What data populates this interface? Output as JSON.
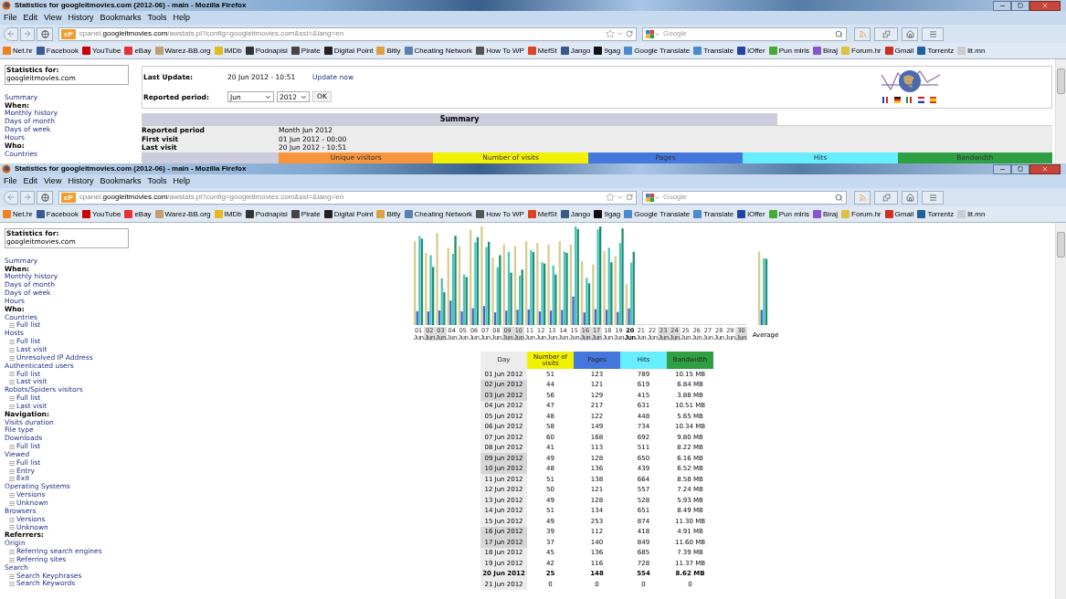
{
  "windows": [
    {
      "title": "Statistics for googleitmovies.com (2012-06) - main - Mozilla Firefox",
      "menu": [
        "File",
        "Edit",
        "View",
        "History",
        "Bookmarks",
        "Tools",
        "Help"
      ],
      "url": {
        "badge": "cP",
        "prefix": "cpanel.",
        "domain": "googleitmovies.com",
        "rest": "/awstats.pl?config=googleitmovies.com&ssl=&lang=en"
      },
      "search_placeholder": "Google",
      "bookmarks": [
        {
          "label": "Net.hr",
          "color": "#f08020"
        },
        {
          "label": "Facebook",
          "color": "#3b5998"
        },
        {
          "label": "YouTube",
          "color": "#cc0000"
        },
        {
          "label": "eBay",
          "color": "#e53238"
        },
        {
          "label": "Warez-BB.org",
          "color": "#c0a070"
        },
        {
          "label": "IMDb",
          "color": "#e6b91e"
        },
        {
          "label": "Podnapisi",
          "color": "#333333"
        },
        {
          "label": "Pirate",
          "color": "#444444"
        },
        {
          "label": "Digital Point",
          "color": "#222222"
        },
        {
          "label": "Bitly",
          "color": "#e0a040"
        },
        {
          "label": "Cheating Network",
          "color": "#5a7fb0"
        },
        {
          "label": "How To WP",
          "color": "#555555"
        },
        {
          "label": "MefSt",
          "color": "#dd4422"
        },
        {
          "label": "Jango",
          "color": "#3a5a8a"
        },
        {
          "label": "9gag",
          "color": "#111111"
        },
        {
          "label": "Google Translate",
          "color": "#4a8ad0"
        },
        {
          "label": "Translate",
          "color": "#4a8ad0"
        },
        {
          "label": "iOffer",
          "color": "#2244aa"
        },
        {
          "label": "Pun miris",
          "color": "#44aa33"
        },
        {
          "label": "Biraj",
          "color": "#8855cc"
        },
        {
          "label": "Forum.hr",
          "color": "#e0c040"
        },
        {
          "label": "Gmail",
          "color": "#d03020"
        },
        {
          "label": "Torrentz",
          "color": "#2060a0"
        },
        {
          "label": "lit.mn",
          "color": "#cccccc"
        }
      ],
      "sidebar": {
        "box_label": "Statistics for:",
        "box_value": "googleitmovies.com",
        "items": [
          {
            "kind": "link",
            "label": "Summary"
          },
          {
            "kind": "heading",
            "label": "When:"
          },
          {
            "kind": "link",
            "label": "Monthly history"
          },
          {
            "kind": "link",
            "label": "Days of month"
          },
          {
            "kind": "link",
            "label": "Days of week"
          },
          {
            "kind": "link",
            "label": "Hours"
          },
          {
            "kind": "heading",
            "label": "Who:"
          },
          {
            "kind": "link",
            "label": "Countries"
          }
        ]
      },
      "content": {
        "kind": "summary",
        "last_update_label": "Last Update:",
        "last_update": "20 Jun 2012 - 10:51",
        "update_link": "Update now",
        "period_label": "Reported period:",
        "month_select": "Jun",
        "year_select": "2012",
        "ok_button": "OK",
        "summary_title": "Summary",
        "summary_rows": [
          {
            "label": "Reported period",
            "value": "Month Jun 2012"
          },
          {
            "label": "First visit",
            "value": "01 Jun 2012 - 00:00"
          },
          {
            "label": "Last visit",
            "value": "20 Jun 2012 - 10:51"
          }
        ],
        "columns": [
          {
            "label": "Unique visitors",
            "color": "#f8953a"
          },
          {
            "label": "Number of visits",
            "color": "#f2f200"
          },
          {
            "label": "Pages",
            "color": "#4477dd"
          },
          {
            "label": "Hits",
            "color": "#66eeff"
          },
          {
            "label": "Bandwidth",
            "color": "#2ea043"
          }
        ]
      }
    },
    {
      "title": "Statistics for googleitmovies.com (2012-06) - main - Mozilla Firefox",
      "menu": [
        "File",
        "Edit",
        "View",
        "History",
        "Bookmarks",
        "Tools",
        "Help"
      ],
      "url": {
        "badge": "cP",
        "prefix": "cpanel.",
        "domain": "googleitmovies.com",
        "rest": "/awstats.pl?config=googleitmovies.com&ssl=&lang=en"
      },
      "search_placeholder": "Google",
      "bookmarks": [
        {
          "label": "Net.hr",
          "color": "#f08020"
        },
        {
          "label": "Facebook",
          "color": "#3b5998"
        },
        {
          "label": "YouTube",
          "color": "#cc0000"
        },
        {
          "label": "eBay",
          "color": "#e53238"
        },
        {
          "label": "Warez-BB.org",
          "color": "#c0a070"
        },
        {
          "label": "IMDb",
          "color": "#e6b91e"
        },
        {
          "label": "Podnapisi",
          "color": "#333333"
        },
        {
          "label": "Pirate",
          "color": "#444444"
        },
        {
          "label": "Digital Point",
          "color": "#222222"
        },
        {
          "label": "Bitly",
          "color": "#e0a040"
        },
        {
          "label": "Cheating Network",
          "color": "#5a7fb0"
        },
        {
          "label": "How To WP",
          "color": "#555555"
        },
        {
          "label": "MefSt",
          "color": "#dd4422"
        },
        {
          "label": "Jango",
          "color": "#3a5a8a"
        },
        {
          "label": "9gag",
          "color": "#111111"
        },
        {
          "label": "Google Translate",
          "color": "#4a8ad0"
        },
        {
          "label": "Translate",
          "color": "#4a8ad0"
        },
        {
          "label": "iOffer",
          "color": "#2244aa"
        },
        {
          "label": "Pun miris",
          "color": "#44aa33"
        },
        {
          "label": "Biraj",
          "color": "#8855cc"
        },
        {
          "label": "Forum.hr",
          "color": "#e0c040"
        },
        {
          "label": "Gmail",
          "color": "#d03020"
        },
        {
          "label": "Torrentz",
          "color": "#2060a0"
        },
        {
          "label": "lit.mn",
          "color": "#cccccc"
        }
      ],
      "sidebar": {
        "box_label": "Statistics for:",
        "box_value": "googleitmovies.com",
        "items": [
          {
            "kind": "link",
            "label": "Summary"
          },
          {
            "kind": "heading",
            "label": "When:"
          },
          {
            "kind": "link",
            "label": "Monthly history"
          },
          {
            "kind": "link",
            "label": "Days of month"
          },
          {
            "kind": "link",
            "label": "Days of week"
          },
          {
            "kind": "link",
            "label": "Hours"
          },
          {
            "kind": "heading",
            "label": "Who:"
          },
          {
            "kind": "link",
            "label": "Countries",
            "children": [
              {
                "label": "Full list"
              }
            ]
          },
          {
            "kind": "link",
            "label": "Hosts",
            "children": [
              {
                "label": "Full list"
              },
              {
                "label": "Last visit"
              },
              {
                "label": "Unresolved IP Address"
              }
            ]
          },
          {
            "kind": "link",
            "label": "Authenticated users",
            "children": [
              {
                "label": "Full list"
              },
              {
                "label": "Last visit"
              }
            ]
          },
          {
            "kind": "link",
            "label": "Robots/Spiders visitors",
            "children": [
              {
                "label": "Full list"
              },
              {
                "label": "Last visit"
              }
            ]
          },
          {
            "kind": "heading",
            "label": "Navigation:"
          },
          {
            "kind": "link",
            "label": "Visits duration"
          },
          {
            "kind": "link",
            "label": "File type"
          },
          {
            "kind": "link",
            "label": "Downloads",
            "children": [
              {
                "label": "Full list"
              }
            ]
          },
          {
            "kind": "link",
            "label": "Viewed",
            "children": [
              {
                "label": "Full list"
              },
              {
                "label": "Entry"
              },
              {
                "label": "Exit"
              }
            ]
          },
          {
            "kind": "link",
            "label": "Operating Systems",
            "children": [
              {
                "label": "Versions"
              },
              {
                "label": "Unknown"
              }
            ]
          },
          {
            "kind": "link",
            "label": "Browsers",
            "children": [
              {
                "label": "Versions"
              },
              {
                "label": "Unknown"
              }
            ]
          },
          {
            "kind": "heading",
            "label": "Referrers:"
          },
          {
            "kind": "link",
            "label": "Origin",
            "children": [
              {
                "label": "Referring search engines"
              },
              {
                "label": "Referring sites"
              }
            ]
          },
          {
            "kind": "link",
            "label": "Search",
            "children": [
              {
                "label": "Search Keyphrases"
              },
              {
                "label": "Search Keywords"
              }
            ]
          }
        ]
      },
      "content": {
        "kind": "days",
        "chart_days": [
          {
            "day": "01",
            "month": "Jun",
            "weekend": false,
            "today": false
          },
          {
            "day": "02",
            "month": "Jun",
            "weekend": true,
            "today": false
          },
          {
            "day": "03",
            "month": "Jun",
            "weekend": true,
            "today": false
          },
          {
            "day": "04",
            "month": "Jun",
            "weekend": false,
            "today": false
          },
          {
            "day": "05",
            "month": "Jun",
            "weekend": false,
            "today": false
          },
          {
            "day": "06",
            "month": "Jun",
            "weekend": false,
            "today": false
          },
          {
            "day": "07",
            "month": "Jun",
            "weekend": false,
            "today": false
          },
          {
            "day": "08",
            "month": "Jun",
            "weekend": false,
            "today": false
          },
          {
            "day": "09",
            "month": "Jun",
            "weekend": true,
            "today": false
          },
          {
            "day": "10",
            "month": "Jun",
            "weekend": true,
            "today": false
          },
          {
            "day": "11",
            "month": "Jun",
            "weekend": false,
            "today": false
          },
          {
            "day": "12",
            "month": "Jun",
            "weekend": false,
            "today": false
          },
          {
            "day": "13",
            "month": "Jun",
            "weekend": false,
            "today": false
          },
          {
            "day": "14",
            "month": "Jun",
            "weekend": false,
            "today": false
          },
          {
            "day": "15",
            "month": "Jun",
            "weekend": false,
            "today": false
          },
          {
            "day": "16",
            "month": "Jun",
            "weekend": true,
            "today": false
          },
          {
            "day": "17",
            "month": "Jun",
            "weekend": true,
            "today": false
          },
          {
            "day": "18",
            "month": "Jun",
            "weekend": false,
            "today": false
          },
          {
            "day": "19",
            "month": "Jun",
            "weekend": false,
            "today": false
          },
          {
            "day": "20",
            "month": "Jun",
            "weekend": false,
            "today": true
          },
          {
            "day": "21",
            "month": "Jun",
            "weekend": false,
            "today": false
          },
          {
            "day": "22",
            "month": "Jun",
            "weekend": false,
            "today": false
          },
          {
            "day": "23",
            "month": "Jun",
            "weekend": true,
            "today": false
          },
          {
            "day": "24",
            "month": "Jun",
            "weekend": true,
            "today": false
          },
          {
            "day": "25",
            "month": "Jun",
            "weekend": false,
            "today": false
          },
          {
            "day": "26",
            "month": "Jun",
            "weekend": false,
            "today": false
          },
          {
            "day": "27",
            "month": "Jun",
            "weekend": false,
            "today": false
          },
          {
            "day": "28",
            "month": "Jun",
            "weekend": false,
            "today": false
          },
          {
            "day": "29",
            "month": "Jun",
            "weekend": false,
            "today": false
          },
          {
            "day": "30",
            "month": "Jun",
            "weekend": true,
            "today": false
          }
        ],
        "average_label": "Average",
        "columns": [
          {
            "label": "Day",
            "color": "#ececec"
          },
          {
            "label": "Number of visits",
            "color": "#f2f200"
          },
          {
            "label": "Pages",
            "color": "#4477dd"
          },
          {
            "label": "Hits",
            "color": "#66eeff"
          },
          {
            "label": "Bandwidth",
            "color": "#2ea043"
          }
        ],
        "rows": [
          {
            "day": "01 Jun 2012",
            "visits": "51",
            "pages": "123",
            "hits": "789",
            "bandwidth": "10.15 MB",
            "weekend": false,
            "today": false
          },
          {
            "day": "02 Jun 2012",
            "visits": "44",
            "pages": "121",
            "hits": "619",
            "bandwidth": "6.84 MB",
            "weekend": true,
            "today": false
          },
          {
            "day": "03 Jun 2012",
            "visits": "56",
            "pages": "129",
            "hits": "415",
            "bandwidth": "3.88 MB",
            "weekend": true,
            "today": false
          },
          {
            "day": "04 Jun 2012",
            "visits": "47",
            "pages": "217",
            "hits": "631",
            "bandwidth": "10.51 MB",
            "weekend": false,
            "today": false
          },
          {
            "day": "05 Jun 2012",
            "visits": "48",
            "pages": "122",
            "hits": "448",
            "bandwidth": "5.65 MB",
            "weekend": false,
            "today": false
          },
          {
            "day": "06 Jun 2012",
            "visits": "58",
            "pages": "149",
            "hits": "734",
            "bandwidth": "10.34 MB",
            "weekend": false,
            "today": false
          },
          {
            "day": "07 Jun 2012",
            "visits": "60",
            "pages": "168",
            "hits": "692",
            "bandwidth": "9.80 MB",
            "weekend": false,
            "today": false
          },
          {
            "day": "08 Jun 2012",
            "visits": "41",
            "pages": "113",
            "hits": "511",
            "bandwidth": "8.22 MB",
            "weekend": false,
            "today": false
          },
          {
            "day": "09 Jun 2012",
            "visits": "49",
            "pages": "128",
            "hits": "650",
            "bandwidth": "6.16 MB",
            "weekend": true,
            "today": false
          },
          {
            "day": "10 Jun 2012",
            "visits": "48",
            "pages": "136",
            "hits": "439",
            "bandwidth": "6.52 MB",
            "weekend": true,
            "today": false
          },
          {
            "day": "11 Jun 2012",
            "visits": "51",
            "pages": "138",
            "hits": "664",
            "bandwidth": "8.58 MB",
            "weekend": false,
            "today": false
          },
          {
            "day": "12 Jun 2012",
            "visits": "50",
            "pages": "121",
            "hits": "557",
            "bandwidth": "7.24 MB",
            "weekend": false,
            "today": false
          },
          {
            "day": "13 Jun 2012",
            "visits": "49",
            "pages": "128",
            "hits": "528",
            "bandwidth": "5.93 MB",
            "weekend": false,
            "today": false
          },
          {
            "day": "14 Jun 2012",
            "visits": "51",
            "pages": "134",
            "hits": "651",
            "bandwidth": "8.49 MB",
            "weekend": false,
            "today": false
          },
          {
            "day": "15 Jun 2012",
            "visits": "49",
            "pages": "253",
            "hits": "874",
            "bandwidth": "11.30 MB",
            "weekend": false,
            "today": false
          },
          {
            "day": "16 Jun 2012",
            "visits": "39",
            "pages": "112",
            "hits": "418",
            "bandwidth": "4.91 MB",
            "weekend": true,
            "today": false
          },
          {
            "day": "17 Jun 2012",
            "visits": "37",
            "pages": "140",
            "hits": "849",
            "bandwidth": "11.60 MB",
            "weekend": true,
            "today": false
          },
          {
            "day": "18 Jun 2012",
            "visits": "45",
            "pages": "136",
            "hits": "685",
            "bandwidth": "7.39 MB",
            "weekend": false,
            "today": false
          },
          {
            "day": "19 Jun 2012",
            "visits": "42",
            "pages": "116",
            "hits": "728",
            "bandwidth": "11.37 MB",
            "weekend": false,
            "today": false
          },
          {
            "day": "20 Jun 2012",
            "visits": "25",
            "pages": "148",
            "hits": "554",
            "bandwidth": "8.62 MB",
            "weekend": false,
            "today": true
          },
          {
            "day": "21 Jun 2012",
            "visits": "0",
            "pages": "0",
            "hits": "0",
            "bandwidth": "0",
            "weekend": false,
            "today": false
          }
        ]
      }
    }
  ]
}
